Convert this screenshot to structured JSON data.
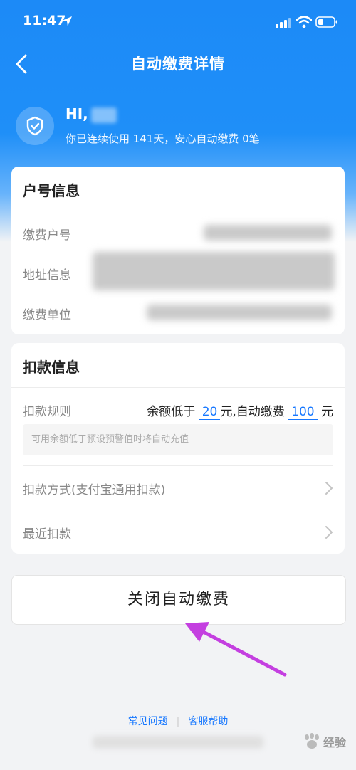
{
  "status_bar": {
    "time": "11:47"
  },
  "nav": {
    "title": "自动缴费详情"
  },
  "greeting": {
    "hi": "HI,",
    "stats": "你已连续使用 141天，安心自动缴费 0笔"
  },
  "account_card": {
    "title": "户号信息",
    "rows": [
      {
        "label": "缴费户号"
      },
      {
        "label": "地址信息"
      },
      {
        "label": "缴费单位"
      }
    ]
  },
  "deduct_card": {
    "title": "扣款信息",
    "rule_label": "扣款规则",
    "rule_prefix": "余额低于",
    "threshold": "20",
    "rule_mid": "元,自动缴费",
    "amount": "100",
    "rule_suffix": "元",
    "hint": "可用余额低于预设预警值时将自动充值",
    "method_label": "扣款方式(支付宝通用扣款)",
    "recent_label": "最近扣款"
  },
  "close_button": {
    "label": "关闭自动缴费"
  },
  "footer": {
    "faq": "常见问题",
    "help": "客服帮助"
  },
  "watermark": {
    "text": "经验"
  },
  "colors": {
    "primary": "#1677ff",
    "header": "#1c8af7",
    "arrow": "#c43fe0"
  },
  "icons": [
    "location-arrow-icon",
    "signal-icon",
    "wifi-icon",
    "battery-icon",
    "back-chevron-icon",
    "shield-check-icon",
    "chevron-right-icon",
    "baidu-paw-icon"
  ]
}
